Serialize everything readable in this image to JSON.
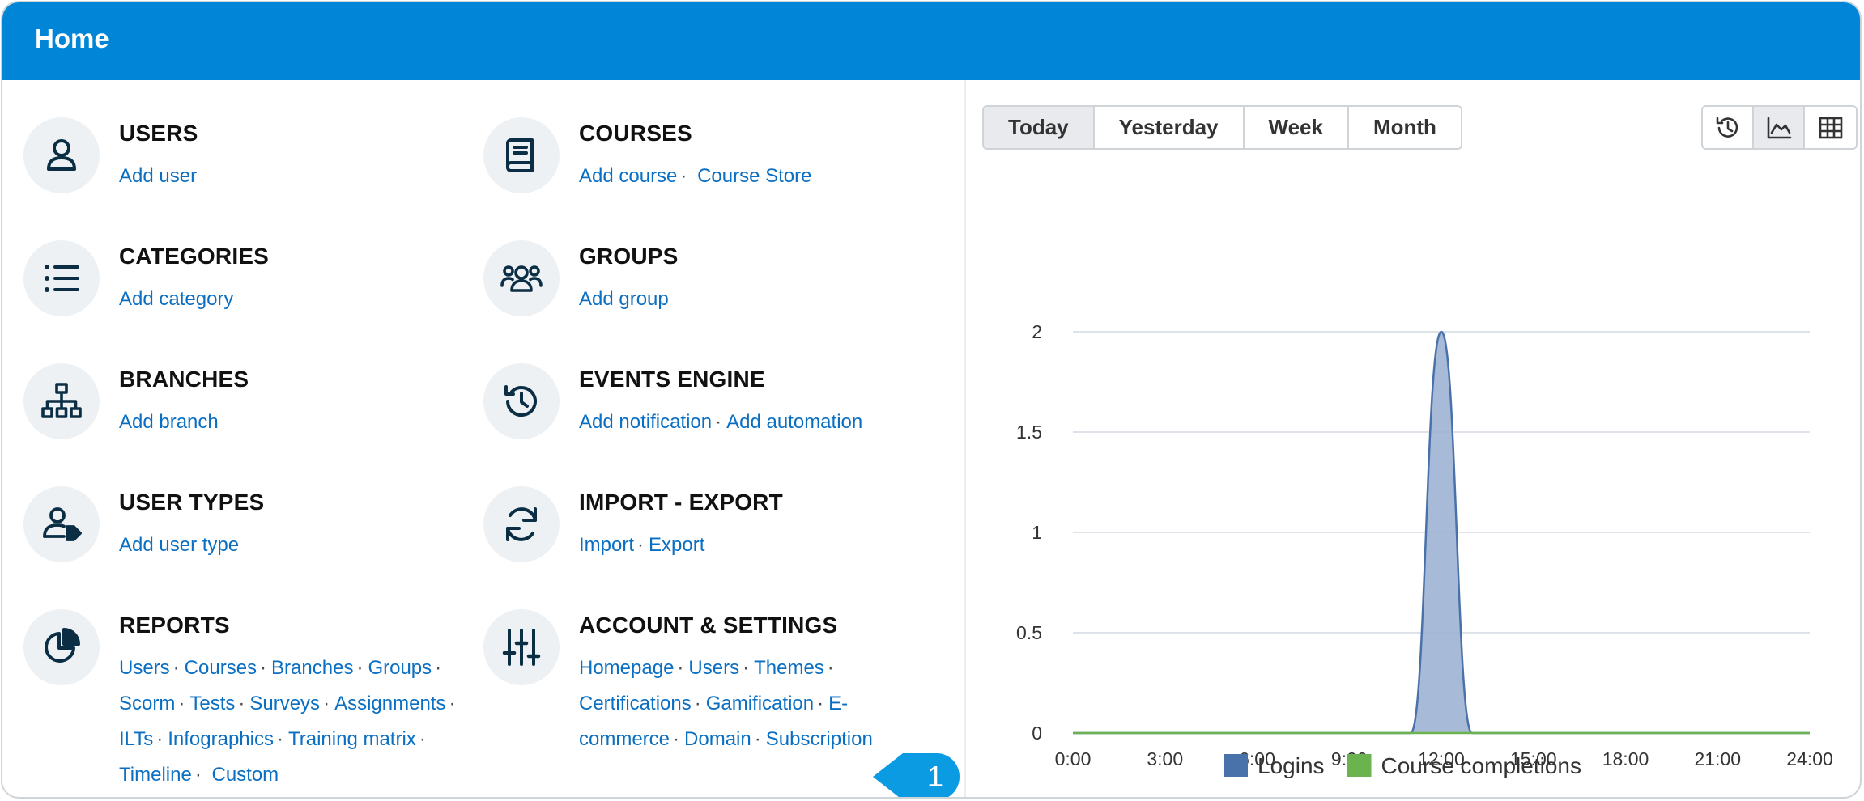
{
  "header": {
    "title": "Home"
  },
  "admin_items": [
    {
      "name": "USERS",
      "icon": "user-icon",
      "links": [
        "Add user"
      ]
    },
    {
      "name": "COURSES",
      "icon": "book-icon",
      "links": [
        "Add course",
        "Course Store"
      ]
    },
    {
      "name": "CATEGORIES",
      "icon": "list-icon",
      "links": [
        "Add category"
      ]
    },
    {
      "name": "GROUPS",
      "icon": "group-icon",
      "links": [
        "Add group"
      ]
    },
    {
      "name": "BRANCHES",
      "icon": "hierarchy-icon",
      "links": [
        "Add branch"
      ]
    },
    {
      "name": "EVENTS ENGINE",
      "icon": "history-icon",
      "links": [
        "Add notification",
        "Add automation"
      ]
    },
    {
      "name": "USER TYPES",
      "icon": "user-tag-icon",
      "links": [
        "Add user type"
      ]
    },
    {
      "name": "IMPORT - EXPORT",
      "icon": "sync-icon",
      "links": [
        "Import",
        "Export"
      ]
    },
    {
      "name": "REPORTS",
      "icon": "pie-chart-icon",
      "links": [
        "Users",
        "Courses",
        "Branches",
        "Groups",
        "Scorm",
        "Tests",
        "Surveys",
        "Assignments",
        "ILTs",
        "Infographics",
        "Training matrix",
        "Timeline",
        "Custom"
      ]
    },
    {
      "name": "ACCOUNT & SETTINGS",
      "icon": "sliders-icon",
      "links": [
        "Homepage",
        "Users",
        "Themes",
        "Certifications",
        "Gamification",
        "E-commerce",
        "Domain",
        "Subscription"
      ]
    }
  ],
  "callout": {
    "label": "1",
    "color": "#0a9be3"
  },
  "period_tabs": {
    "items": [
      "Today",
      "Yesterday",
      "Week",
      "Month"
    ],
    "selected": "Today"
  },
  "view_buttons": [
    {
      "icon": "history-icon",
      "active": false
    },
    {
      "icon": "area-chart-icon",
      "active": true
    },
    {
      "icon": "table-icon",
      "active": false
    }
  ],
  "chart_data": {
    "type": "area",
    "x_ticks": [
      "0:00",
      "3:00",
      "6:00",
      "9:00",
      "12:00",
      "15:00",
      "18:00",
      "21:00",
      "24:00"
    ],
    "y_ticks": [
      "0",
      "0.5",
      "1",
      "1.5",
      "2"
    ],
    "ylim": [
      0,
      2
    ],
    "xlim": [
      0,
      24
    ],
    "grid": true,
    "legend_position": "bottom",
    "series": [
      {
        "name": "Logins",
        "color": "#4a72aa",
        "fill": "#9db2d3",
        "points": [
          [
            0,
            0
          ],
          [
            11,
            0
          ],
          [
            12,
            2
          ],
          [
            13,
            0
          ],
          [
            24,
            0
          ]
        ]
      },
      {
        "name": "Course completions",
        "color": "#6bb34f",
        "fill": "#7fbf5a",
        "points": [
          [
            0,
            0
          ],
          [
            24,
            0
          ]
        ]
      }
    ]
  }
}
